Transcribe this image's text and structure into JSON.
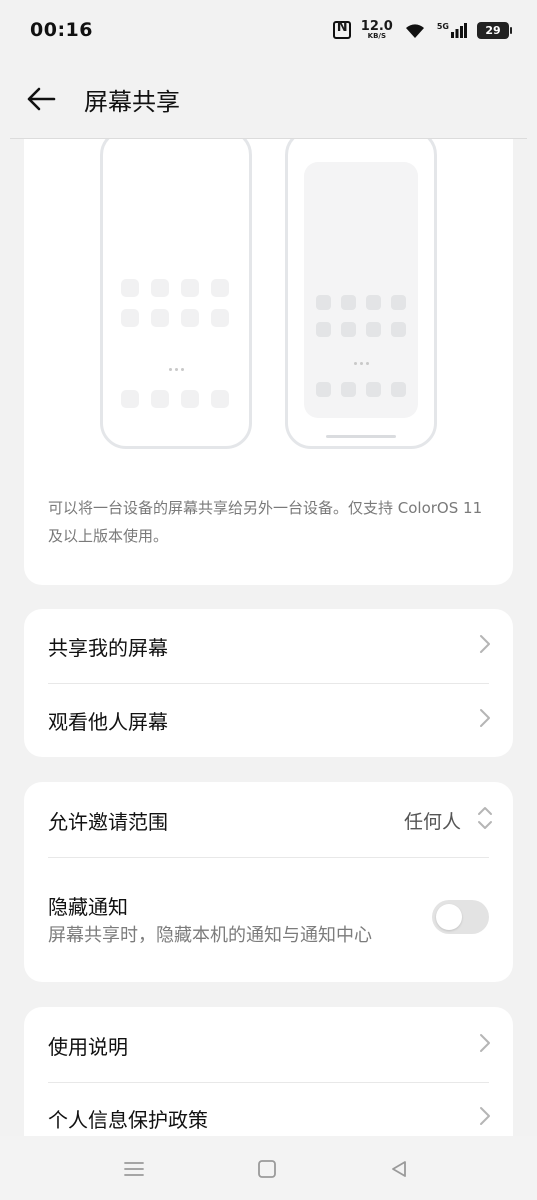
{
  "status_bar": {
    "time": "00:16",
    "net_speed_value": "12.0",
    "net_speed_unit": "KB/S",
    "network": "5G",
    "battery": "29"
  },
  "header": {
    "title": "屏幕共享"
  },
  "intro": {
    "description": "可以将一台设备的屏幕共享给另外一台设备。仅支持 ColorOS 11 及以上版本使用。"
  },
  "share_section": {
    "items": [
      {
        "label": "共享我的屏幕"
      },
      {
        "label": "观看他人屏幕"
      }
    ]
  },
  "settings_section": {
    "invite_scope_label": "允许邀请范围",
    "invite_scope_value": "任何人",
    "hide_notifications_label": "隐藏通知",
    "hide_notifications_desc": "屏幕共享时，隐藏本机的通知与通知中心",
    "hide_notifications_on": false
  },
  "info_section": {
    "items": [
      {
        "label": "使用说明"
      },
      {
        "label": "个人信息保护政策"
      }
    ]
  },
  "colors": {
    "background": "#f2f2f2",
    "card": "#ffffff",
    "text_primary": "#111111",
    "text_secondary": "#7a7a7a"
  }
}
